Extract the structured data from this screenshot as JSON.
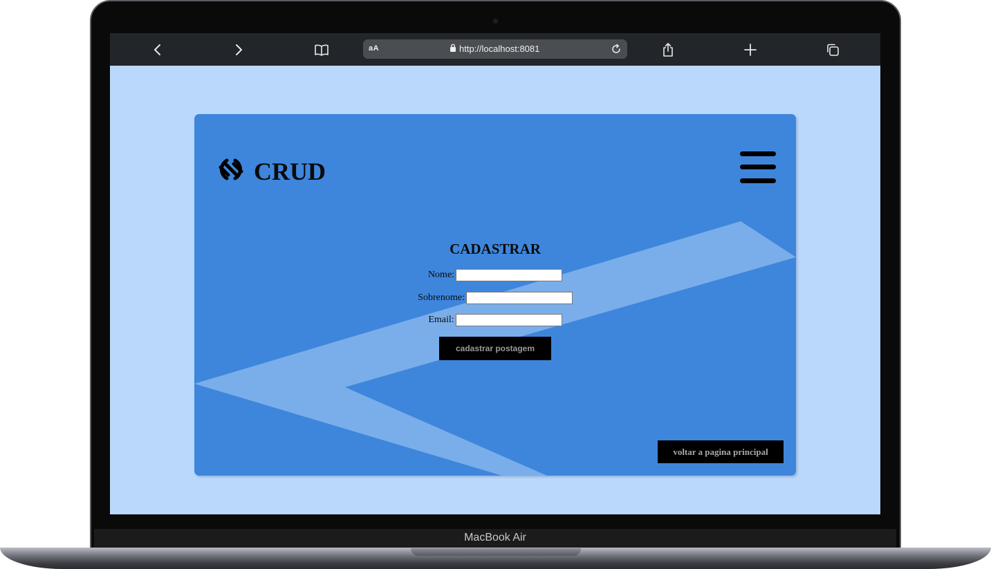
{
  "device": {
    "label": "MacBook Air"
  },
  "browser": {
    "text_size_label": "aA",
    "url": "http://localhost:8081",
    "toolbar_icons": [
      "back-icon",
      "forward-icon",
      "bookmarks-icon",
      "share-icon",
      "new-tab-icon",
      "tabs-icon"
    ]
  },
  "page": {
    "logo_text": "CRUD",
    "form": {
      "title": "CADASTRAR",
      "fields": [
        {
          "label": "Nome:",
          "value": ""
        },
        {
          "label": "Sobrenome:",
          "value": ""
        },
        {
          "label": "Email:",
          "value": ""
        }
      ],
      "submit_label": "cadastrar postagem"
    },
    "back_label": "voltar a pagina principal"
  },
  "colors": {
    "page_background": "#bad8fb",
    "card_background": "#3e86dc",
    "card_accent": "#7aaeea",
    "button_background": "#000000"
  }
}
